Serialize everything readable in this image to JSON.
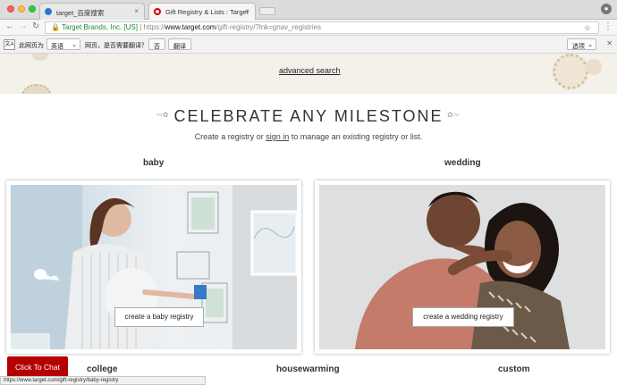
{
  "browser": {
    "tabs": [
      {
        "title": "target_百度搜索",
        "close_label": "×"
      },
      {
        "title": "Gift Registry & Lists : Target",
        "close_label": "×"
      }
    ],
    "url": {
      "secure_label": "Target Brands, Inc. [US]",
      "scheme": "https://",
      "host": "www.target.com",
      "path": "/gift-registry/?lnk=gnav_registries"
    },
    "status_url": "https://www.target.com/gift-registry/baby-registry"
  },
  "translate_bar": {
    "icon_text": "文A",
    "prefix": "此网页为",
    "language": "英语",
    "question": "网页，是否需要翻译？",
    "no_label": "否",
    "yes_label": "翻译",
    "options_label": "选项"
  },
  "page": {
    "advanced_search": "advanced search",
    "headline": "CELEBRATE ANY MILESTONE",
    "sub_before": "Create a registry or ",
    "sub_link": "sign in",
    "sub_after": " to manage an existing registry or list.",
    "categories": [
      {
        "title": "baby",
        "cta": "create a baby registry"
      },
      {
        "title": "wedding",
        "cta": "create a wedding registry"
      },
      {
        "title": "college"
      },
      {
        "title": "housewarming"
      },
      {
        "title": "custom"
      }
    ],
    "chat_label": "Click To Chat"
  }
}
